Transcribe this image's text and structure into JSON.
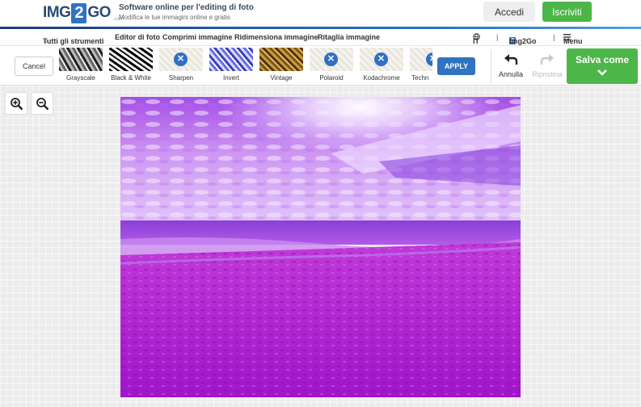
{
  "header": {
    "logo": {
      "img": "IMG",
      "two": "2",
      "go": "GO",
      "dotcom": ".com"
    },
    "tagline_title": "Software online per l'editing di foto",
    "tagline_sub": "Modifica le tue immagini online e gratis",
    "login_label": "Accedi",
    "signup_label": "Iscriviti"
  },
  "nav": {
    "all_tools": "Tutti gli strumenti",
    "links": [
      "Editor di foto",
      "Comprimi immagine",
      "Ridimensiona immagine",
      "Ritaglia immagine"
    ],
    "language": "IT",
    "separator": "|",
    "brand": "Img2Go",
    "menu": "Menu"
  },
  "toolbar": {
    "cancel_label": "Cancel",
    "filters": [
      {
        "label": "Grayscale",
        "state": "preview"
      },
      {
        "label": "Black & White",
        "state": "preview"
      },
      {
        "label": "Sharpen",
        "state": "loading"
      },
      {
        "label": "Invert",
        "state": "preview"
      },
      {
        "label": "Vintage",
        "state": "preview"
      },
      {
        "label": "Polaroid",
        "state": "loading"
      },
      {
        "label": "Kodachrome",
        "state": "loading"
      },
      {
        "label": "Techn",
        "state": "loading"
      }
    ],
    "apply_label": "APPLY",
    "undo_label": "Annulla",
    "redo_label": "Ripristina",
    "save_label": "Salva come"
  },
  "icons": {
    "zoom_in": "zoom-in-icon",
    "zoom_out": "zoom-out-icon",
    "undo": "undo-arrow-icon",
    "redo": "redo-arrow-icon",
    "globe": "globe-icon",
    "hamburger": "hamburger-menu-icon"
  },
  "colors": {
    "brand_blue": "#2f73c1",
    "green_cta": "#4cb748",
    "image_tint": "#a020f0"
  }
}
